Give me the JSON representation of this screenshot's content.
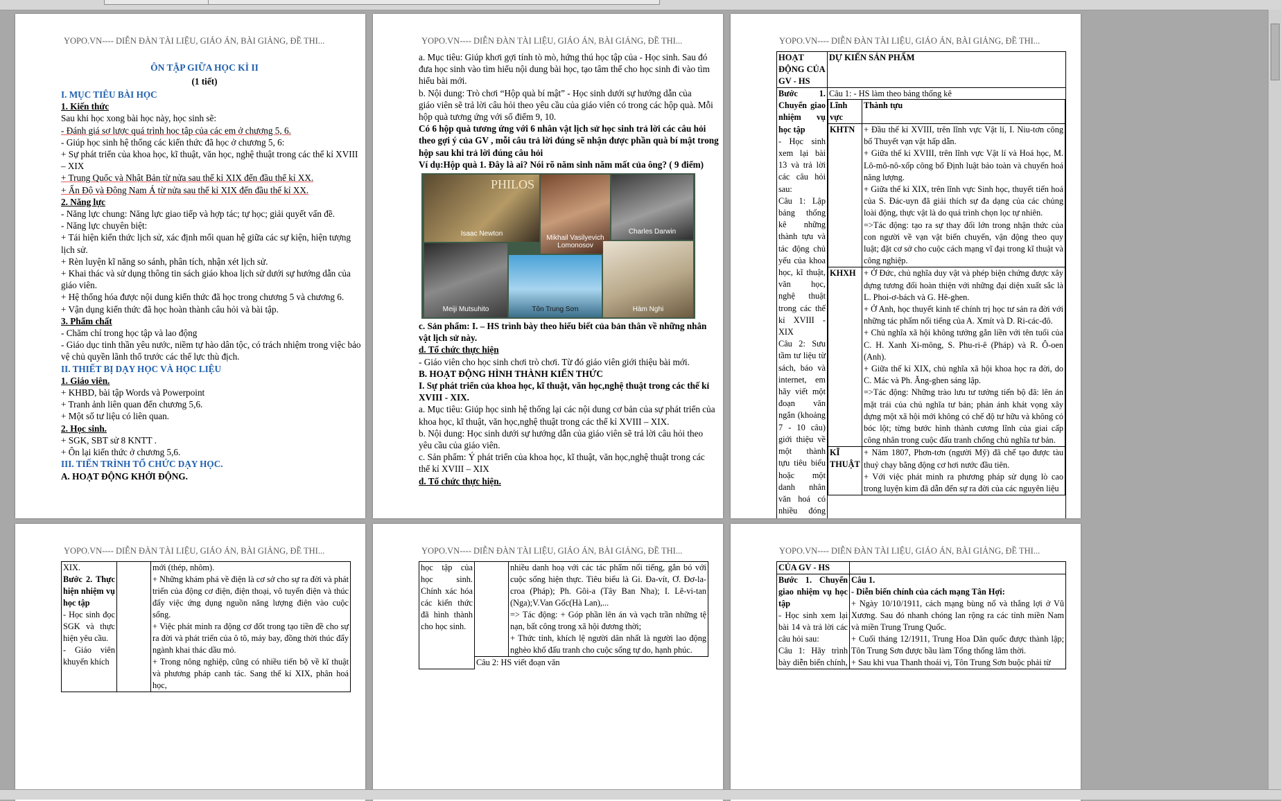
{
  "header": "YOPO.VN---- DIỄN ĐÀN TÀI LIỆU, GIÁO ÁN, BÀI GIẢNG, ĐỀ THI...",
  "page1": {
    "title": "ÔN TẬP GIỮA HỌC KÌ II",
    "subtitle": "(1 tiết)",
    "lines": [
      {
        "t": "I. MỤC TIÊU BÀI HỌC",
        "c": "blue"
      },
      {
        "t": "1. Kiến thức",
        "c": "b u"
      },
      {
        "t": "Sau khi học xong bài học này, học sinh sẽ:",
        "c": ""
      },
      {
        "t": "- Đánh giá sơ lược quá trình học tập của các em ở chương 5, 6.",
        "c": "red-u"
      },
      {
        "t": "- Giúp học sinh hệ thống các kiến thức đã học ở chương 5, 6:",
        "c": ""
      },
      {
        "t": "+ Sự phát triển của khoa học, kĩ thuật, văn học, nghệ thuật trong các thế kỉ XVIII",
        "c": ""
      },
      {
        "t": "– XIX",
        "c": ""
      },
      {
        "t": "+ Trung Quốc và Nhật Bản từ nửa sau thế kỉ XIX đến đầu thế kỉ XX.",
        "c": "red-u"
      },
      {
        "t": "+ Ấn Độ và Đông Nam Á từ nửa sau thế kỉ XIX đến đầu thế kỉ XX.",
        "c": "red-u"
      },
      {
        "t": "2. Năng lực",
        "c": "b u"
      },
      {
        "t": "- Năng lực chung: Năng lực giao tiếp và hợp tác; tự học; giải quyết vấn đề.",
        "c": ""
      },
      {
        "t": "- Năng lực chuyên biệt:",
        "c": ""
      },
      {
        "t": "+ Tái hiện kiến thức lịch sử, xác định mối quan hệ giữa các sự kiện, hiện tượng",
        "c": ""
      },
      {
        "t": "lịch sử.",
        "c": ""
      },
      {
        "t": "+ Rèn luyện kĩ năng so sánh, phân tích, nhận xét lịch sử.",
        "c": ""
      },
      {
        "t": "+ Khai thác và sử dụng thông tin sách giáo khoa lịch sử dưới sự hướng dẫn của",
        "c": ""
      },
      {
        "t": "giáo viên.",
        "c": ""
      },
      {
        "t": "+ Hệ thống hóa được nội dung kiến thức đã học trong chương 5 và chương 6.",
        "c": ""
      },
      {
        "t": "+ Vận dụng kiến thức đã học hoàn thành câu hỏi và bài tập.",
        "c": ""
      },
      {
        "t": "3. Phẩm chất",
        "c": "b u"
      },
      {
        "t": "- Chăm chỉ trong học tập và lao động",
        "c": ""
      },
      {
        "t": "- Giáo dục tinh thần yêu nước, niềm tự hào dân tộc, có trách nhiệm trong việc bảo",
        "c": ""
      },
      {
        "t": "vệ chủ quyền lãnh thổ trước các thế lực thù địch.",
        "c": ""
      },
      {
        "t": "II. THIẾT BỊ DẠY HỌC VÀ HỌC LIỆU",
        "c": "blue"
      },
      {
        "t": " 1. Giáo viên.",
        "c": "b u"
      },
      {
        "t": "+ KHBD, bài tập Words và Powerpoint",
        "c": ""
      },
      {
        "t": "+ Tranh ảnh liên quan đến chương 5,6.",
        "c": ""
      },
      {
        "t": "+ Một số tư liệu có liên quan.",
        "c": ""
      },
      {
        "t": "2. Học sinh.",
        "c": "b u"
      },
      {
        "t": "+ SGK, SBT sử 8 KNTT .",
        "c": ""
      },
      {
        "t": "+ Ôn lại kiến thức ở chương 5,6.",
        "c": ""
      },
      {
        "t": "III. TIẾN TRÌNH TỔ CHỨC DẠY HỌC.",
        "c": "blue"
      },
      {
        "t": "A. HOẠT ĐỘNG KHỞI ĐỘNG.",
        "c": "b"
      }
    ]
  },
  "page2": {
    "lines_top": [
      {
        "t": "a. Mục tiêu: Giúp khơi gợi tính tò mò, hứng thú học tập của - Học sinh. Sau đó",
        "c": ""
      },
      {
        "t": "đưa học sinh vào tìm hiểu nội dung bài học, tạo tâm thế cho học sinh đi vào tìm",
        "c": ""
      },
      {
        "t": "hiểu bài mới.",
        "c": ""
      },
      {
        "t": "b. Nội dung: Trò chơi “Hộp quà bí mật” - Học sinh dưới sự hướng dẫn của",
        "c": ""
      },
      {
        "t": "giáo viên sẽ trả lời câu hỏi theo yêu cầu của giáo viên có trong các hộp quà. Mỗi",
        "c": ""
      },
      {
        "t": "hộp quà tương ứng với số điểm 9, 10.",
        "c": ""
      },
      {
        "t": "Có 6 hộp quà tương ứng với 6 nhân vật lịch sử học sinh trả lời các câu hỏi",
        "c": "b"
      },
      {
        "t": "theo gợi ý của GV , mỗi câu trả lời đúng sẽ nhận được phần quà bí mật trong",
        "c": "b"
      },
      {
        "t": "hộp sau khi trả lời đúng câu hỏi",
        "c": "b"
      },
      {
        "t": "Ví dụ:Hộp quà 1. Đây là ai? Nói rõ năm sinh năm mất của ông? ( 9 điểm)",
        "c": "b"
      }
    ],
    "photo_captions": [
      "Isaac Newton",
      "Mikhail Vasilyevich Lomonosov",
      "Charles Darwin",
      "Meiji Mutsuhito",
      "Tôn Trung Sơn",
      "Hàm Nghi"
    ],
    "photo_text": "PHILOS",
    "lines_bottom": [
      {
        "t": "c. Sản phẩm: I. – HS trình bày theo hiểu biết của bản thân về những nhân",
        "c": "b"
      },
      {
        "t": "vật lịch sử này.",
        "c": "b"
      },
      {
        "t": "d. Tổ chức thực hiện",
        "c": "b u"
      },
      {
        "t": "- Giáo viên cho học sinh chơi trò chơi. Từ đó giáo viên giới thiệu bài mới.",
        "c": ""
      },
      {
        "t": "B. HOẠT ĐỘNG HÌNH THÀNH KIẾN THỨC",
        "c": "b"
      },
      {
        "t": "I. Sự phát triển của khoa học, kĩ thuật, văn học,nghệ thuật trong các thế kỉ",
        "c": "b"
      },
      {
        "t": "XVIII - XIX.",
        "c": "b"
      },
      {
        "t": "a. Mục tiêu: Giúp học sinh hệ thống lại các nội dung cơ bản của sự phát triển của",
        "c": ""
      },
      {
        "t": "khoa học, kĩ thuật, văn học,nghệ thuật trong các thế kỉ XVIII – XIX.",
        "c": ""
      },
      {
        "t": "b. Nội dung: Học sinh dưới sự hướng dẫn của giáo viên sẽ trả lời câu hỏi theo",
        "c": ""
      },
      {
        "t": "yêu cầu của giáo viên.",
        "c": ""
      },
      {
        "t": "c. Sản phẩm: Ý phát triển của khoa học, kĩ thuật, văn học,nghệ thuật trong các",
        "c": ""
      },
      {
        "t": "thế kỉ XVIII – XIX",
        "c": ""
      },
      {
        "t": "d. Tổ chức thực hiện.",
        "c": "b u"
      }
    ]
  },
  "page3": {
    "col1_head": "HOẠT ĐỘNG CỦA GV - HS",
    "col2_head": "DỰ KIẾN SẢN PHẨM",
    "col1_body": [
      "Bước 1. Chuyển giao nhiệm vụ học tập",
      "- Học sinh xem lại bài 13 và trả lời các câu hỏi sau:",
      "Câu 1: Lập bảng thống kê những thành tựu và tác động chủ yếu của khoa học, kĩ thuật, văn học, nghệ thuật trong các thế kỉ XVIII - XIX",
      "Câu 2: Sưu tầm tư liệu từ sách, báo và internet, em hãy viết một đoạn văn ngắn (khoảng 7 - 10 câu) giới thiệu về một thành tựu tiêu biểu hoặc một danh nhân văn hoá có nhiều đóng góp trong các thế kỉ XVIII –"
    ],
    "cau1": "Câu 1:  - HS làm theo bảng thống kê",
    "inner_h1": "Lĩnh vực",
    "inner_h2": "Thành tựu",
    "rows": [
      {
        "field": "KHTN",
        "text": [
          "+ Đầu thế kỉ XVIII, trên lĩnh vực Vật lí, I. Niu-tơn công bố Thuyết vạn vật hấp dẫn.",
          "+ Giữa thế kỉ XVIII, trên lĩnh vực Vật lí và Hoá học, M. Lô-mô-nô-xốp công bố Định luật bảo toàn và chuyển hoá năng lượng.",
          "+ Giữa thế kỉ XIX, trên lĩnh vực Sinh học, thuyết tiến hoá của S. Đác-uyn đã giải thích sự đa dạng của các chủng loài động, thực vật là do quá trình chọn lọc tự nhiên.",
          "=>Tác động: tạo ra sự thay đổi lớn trong nhận thức của con người về vạn vật biến chuyển, vận động theo quy luật; đặt cơ sở cho cuộc cách mạng vĩ đại trong kĩ thuật và công nghiệp."
        ]
      },
      {
        "field": "KHXH",
        "text": [
          "+ Ở Đức, chủ nghĩa duy vật và phép biện chứng được xây dựng tương đối hoàn thiện với những đại diện xuất sắc là L. Phoi-ơ-bách và G. Hê-ghen.",
          "+ Ở Anh, học thuyết kinh tế chính trị học tư sản ra đời với những tác phẩm nổi tiếng của A. Xmít và D. Ri-các-đô.",
          "+ Chủ nghĩa xã hội không tưởng gắn liền với tên tuổi của C. H. Xanh Xi-mông, S. Phu-ri-ê (Pháp) và R. Ô-oen (Anh).",
          "+ Giữa thế kỉ XIX, chủ nghĩa xã hội khoa học ra đời, do C. Mác và Ph. Ăng-ghen sáng lập.",
          "=>Tác động: Những trào lưu tư tưởng tiến bộ đã: lên án mặt trái của chủ nghĩa tư bản; phản ánh khát vọng xây dựng một xã hội mới không có chế độ tư hữu và không có bóc lột; từng bước hình thành cương lĩnh của giai cấp công nhân trong cuộc đấu tranh chống chủ nghĩa tư bản."
        ]
      },
      {
        "field": "KĨ THUẬT",
        "text": [
          "+ Năm 1807, Phơn-tơn (người Mỹ) đã chế tạo được tàu thuỷ chạy bằng động cơ hơi nước đầu tiên.",
          "+ Với việc phát minh ra phương pháp sử dụng lò cao trong luyện kim đã dẫn đến sự ra đời của các nguyên liệu"
        ]
      }
    ]
  },
  "page4": {
    "col1": [
      "XIX.",
      "Bước 2. Thực hiện nhiệm vụ học tập",
      "- Học sinh đọc SGK và thực hiện yêu cầu.",
      "- Giáo viên khuyến khích"
    ],
    "col3": [
      "mới (thép, nhôm).",
      "+ Những khám phá về điện là cơ sở cho sự ra đời và phát triển của động cơ điện, điện thoại, vô tuyến điện và thúc đẩy việc ứng dụng nguồn năng lượng điện vào cuộc sống.",
      "+ Việc phát minh ra động cơ đốt trong tạo tiền đề cho sự ra đời và phát triển của ô tô, máy bay, đồng thời thúc đẩy ngành khai thác dầu mỏ.",
      "+ Trong nông nghiệp, cũng có nhiều tiến bộ về kĩ thuật và phương pháp canh tác. Sang thế kỉ XIX, phân hoá học,"
    ]
  },
  "page5": {
    "col1": [
      "học tập của học sinh. Chính xác hóa các kiến thức đã hình thành cho học sinh."
    ],
    "col3": [
      "nhiều danh hoạ với các tác phẩm nổi tiếng, gắn bó với cuộc sống hiện thực. Tiêu biểu là Gi. Đa-vít, Ơ. Đơ-la-croa (Pháp); Ph. Gôi-a (Tây Ban Nha); I. Lê-vi-tan (Nga);V.Van Gốc(Hà Lan),...",
      "=> Tác động: + Góp phần lên án và vạch trần những tệ nạn, bất công trong xã hội đương thời;",
      "+ Thức tỉnh, khích lệ người dân nhất là người lao động nghèo khổ đấu tranh cho cuộc sống tự do, hạnh phúc."
    ],
    "cau2": "Câu 2:  HS viết đoạn văn"
  },
  "page6": {
    "col1_head": "CỦA GV - HS",
    "col1": [
      "Bước 1. Chuyển giao nhiệm vụ học tập",
      "- Học sinh xem lại bài 14 và trả lời các câu hỏi sau:",
      "Câu 1: Hãy trình bày diễn biến chính,"
    ],
    "col2": [
      "Câu 1.",
      "- Diễn biến chính của cách mạng Tân Hợi:",
      "+ Ngày 10/10/1911, cách mạng bùng nổ và thắng lợi ở Vũ Xương. Sau đó nhanh chóng lan rộng ra các tỉnh miền Nam và miền Trung Trung Quốc.",
      "+ Cuối tháng 12/1911, Trung Hoa Dân quốc được thành lập; Tôn Trung Sơn được bầu làm Tổng thống lâm thời.",
      "+ Sau khi vua Thanh thoái vị, Tôn Trung Sơn buộc phải từ"
    ]
  }
}
